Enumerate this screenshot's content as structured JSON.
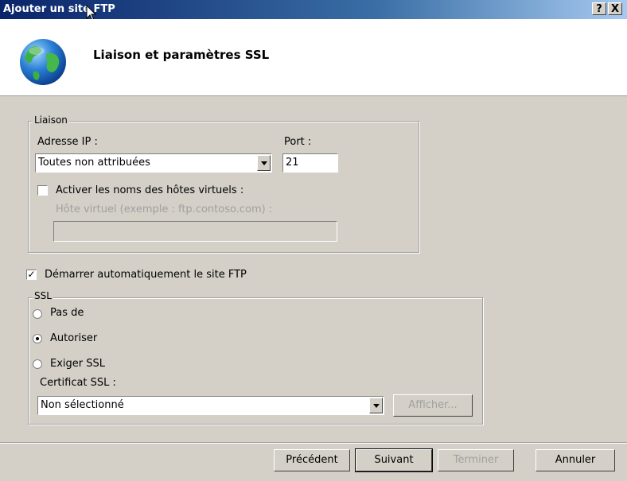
{
  "window": {
    "title": "Ajouter un site FTP",
    "help_label": "?",
    "close_label": "X"
  },
  "header": {
    "title": "Liaison et paramètres SSL",
    "icon": "globe-icon"
  },
  "binding": {
    "legend": "Liaison",
    "ip_label": "Adresse IP :",
    "ip_value": "Toutes non attribuées",
    "port_label": "Port :",
    "port_value": "21",
    "virtual_hosts_label": "Activer les noms des hôtes virtuels :",
    "virtual_hosts_checked": false,
    "virtual_host_label": "Hôte virtuel (exemple : ftp.contoso.com) :",
    "virtual_host_value": ""
  },
  "autostart": {
    "label": "Démarrer automatiquement le site FTP",
    "checked": true
  },
  "ssl": {
    "legend": "SSL",
    "options": [
      {
        "label": "Pas de",
        "selected": false
      },
      {
        "label": "Autoriser",
        "selected": true
      },
      {
        "label": "Exiger SSL",
        "selected": false
      }
    ],
    "cert_label": "Certificat SSL :",
    "cert_value": "Non sélectionné",
    "view_button": "Afficher..."
  },
  "buttons": {
    "previous": "Précédent",
    "next": "Suivant",
    "finish": "Terminer",
    "cancel": "Annuler"
  }
}
